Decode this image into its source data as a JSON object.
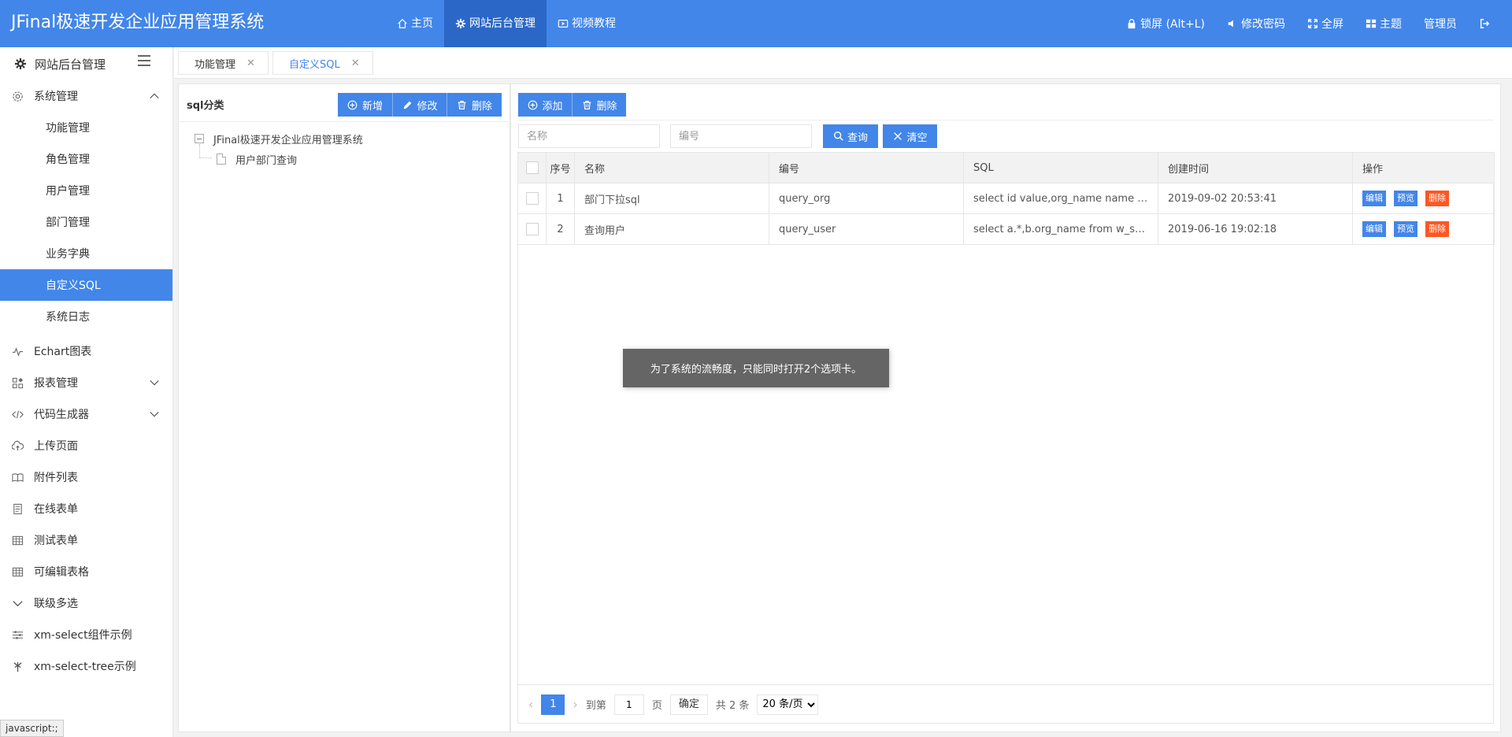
{
  "app": {
    "title": "JFinal极速开发企业应用管理系统"
  },
  "topnav": {
    "home": "主页",
    "admin": "网站后台管理",
    "video": "视频教程"
  },
  "rightnav": {
    "lock": "锁屏 (Alt+L)",
    "password": "修改密码",
    "fullscreen": "全屏",
    "theme": "主题",
    "user": "管理员"
  },
  "sidebar": {
    "title": "网站后台管理",
    "group": "系统管理",
    "sub_items": [
      "功能管理",
      "角色管理",
      "用户管理",
      "部门管理",
      "业务字典",
      "自定义SQL",
      "系统日志"
    ],
    "active_sub": "自定义SQL",
    "items": [
      "Echart图表",
      "报表管理",
      "代码生成器",
      "上传页面",
      "附件列表",
      "在线表单",
      "测试表单",
      "可编辑表格",
      "联级多选",
      "xm-select组件示例",
      "xm-select-tree示例"
    ]
  },
  "tabs": [
    {
      "label": "功能管理",
      "active": false
    },
    {
      "label": "自定义SQL",
      "active": true
    }
  ],
  "left_panel": {
    "title": "sql分类",
    "btn_new": "新增",
    "btn_edit": "修改",
    "btn_delete": "删除",
    "tree_root": "JFinal极速开发企业应用管理系统",
    "tree_child": "用户部门查询"
  },
  "right_panel": {
    "btn_add": "添加",
    "btn_delete": "删除",
    "name_placeholder": "名称",
    "code_placeholder": "编号",
    "btn_query": "查询",
    "btn_clear": "清空"
  },
  "table": {
    "headers": [
      "序号",
      "名称",
      "编号",
      "SQL",
      "创建时间",
      "操作"
    ],
    "rows": [
      {
        "no": "1",
        "name": "部门下拉sql",
        "code": "query_org",
        "sql": "select id value,org_name name fro...",
        "created": "2019-09-02 20:53:41"
      },
      {
        "no": "2",
        "name": "查询用户",
        "code": "query_user",
        "sql": "select a.*,b.org_name from w_sys...",
        "created": "2019-06-16 19:02:18"
      }
    ],
    "action_edit": "编辑",
    "action_preview": "预览",
    "action_delete": "删除"
  },
  "pager": {
    "current": "1",
    "goto_label": "到第",
    "page_value": "1",
    "page_label": "页",
    "confirm": "确定",
    "total": "共 2 条",
    "page_size": "20 条/页"
  },
  "toast": "为了系统的流畅度，只能同时打开2个选项卡。",
  "statusbar": "javascript:;",
  "colors": {
    "primary": "#4286e9",
    "primary_dark": "#2b67c7",
    "danger": "#ff5722"
  }
}
